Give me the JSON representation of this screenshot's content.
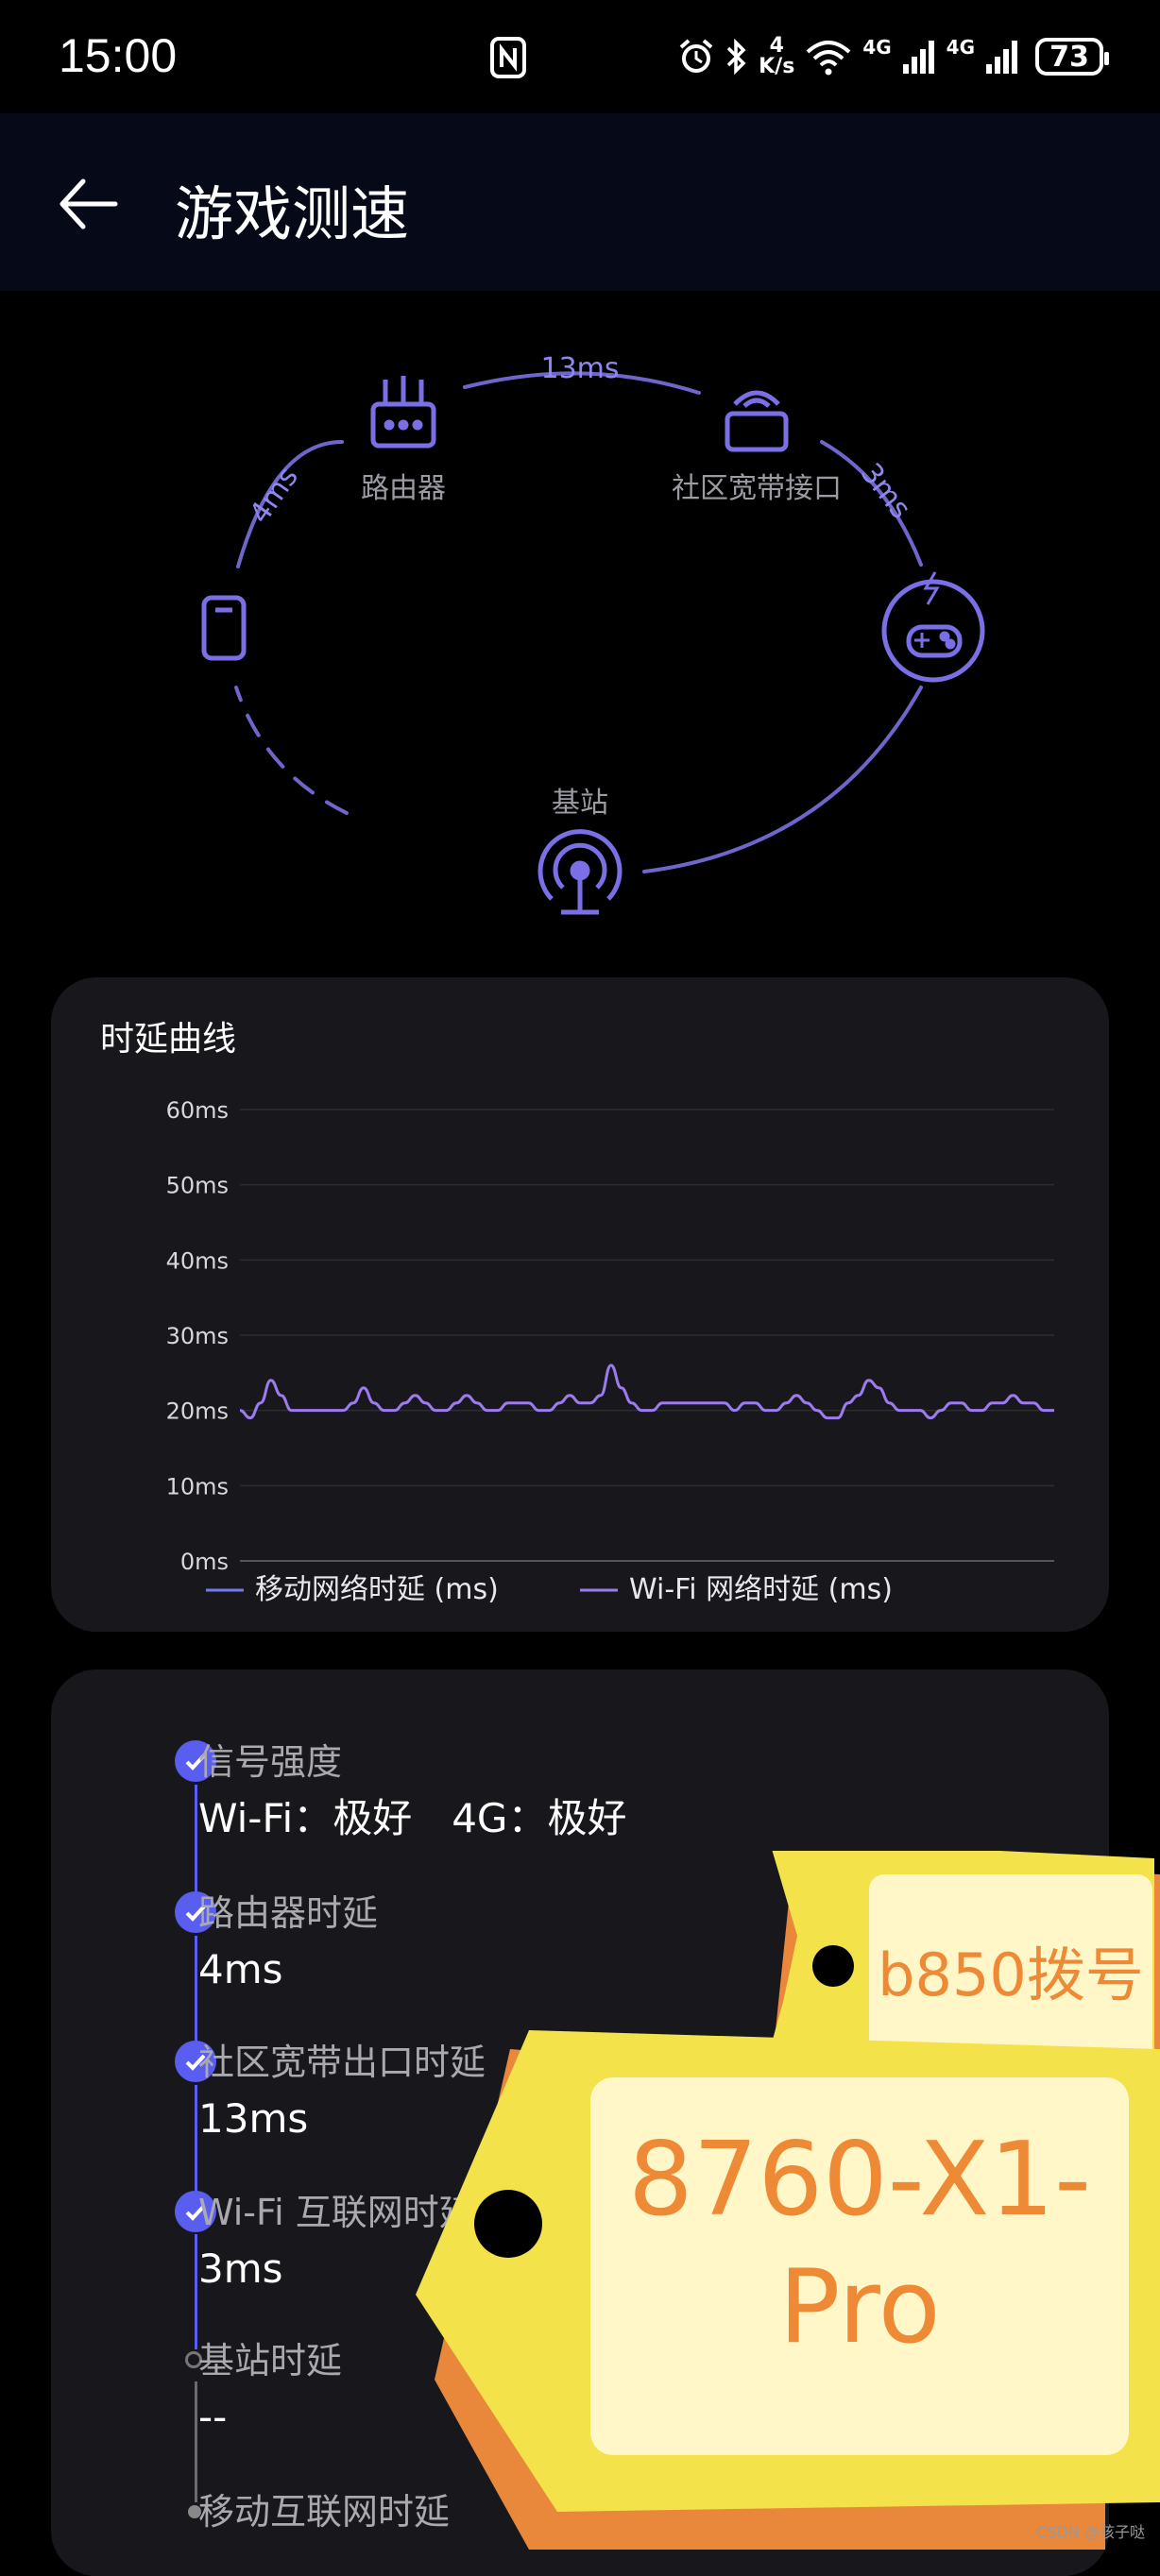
{
  "status_bar": {
    "time": "15:00",
    "net_speed_value": "4",
    "net_speed_unit": "K/s",
    "network_1": "4G",
    "network_2": "4G",
    "battery": "73"
  },
  "header": {
    "title": "游戏测速",
    "back_icon": "arrow-left-icon"
  },
  "topology": {
    "router_label": "路由器",
    "broadband_label": "社区宽带接口",
    "base_station_label": "基站",
    "phone_router_latency": "4ms",
    "router_broadband_latency": "13ms",
    "broadband_game_latency": "3ms",
    "accent_color": "#7b6fe6"
  },
  "chart": {
    "title": "时延曲线",
    "chart_data": {
      "type": "line",
      "title": "时延曲线",
      "ylim": [
        0,
        60
      ],
      "y_ticks": [
        "0ms",
        "10ms",
        "20ms",
        "30ms",
        "40ms",
        "50ms",
        "60ms"
      ],
      "grid": true,
      "legend_placement": "bottom",
      "series": [
        {
          "name": "移动网络时延 (ms)",
          "color": "#6f7cf0",
          "values": []
        },
        {
          "name": "Wi-Fi 网络时延 (ms)",
          "color": "#9b7bee",
          "values": [
            20,
            19,
            21,
            24,
            22,
            20,
            20,
            20,
            20,
            20,
            20,
            21,
            23,
            21,
            20,
            20,
            21,
            22,
            21,
            20,
            20,
            21,
            22,
            21,
            20,
            20,
            21,
            21,
            21,
            20,
            20,
            21,
            22,
            21,
            21,
            22,
            26,
            23,
            21,
            20,
            20,
            21,
            21,
            21,
            21,
            21,
            21,
            21,
            20,
            21,
            21,
            20,
            20,
            21,
            22,
            21,
            20,
            19,
            19,
            21,
            22,
            24,
            23,
            21,
            20,
            20,
            20,
            19,
            20,
            21,
            21,
            20,
            20,
            21,
            21,
            22,
            21,
            21,
            20,
            20
          ]
        }
      ]
    }
  },
  "checklist": {
    "items": [
      {
        "label": "信号强度",
        "value": "Wi-Fi：极好　4G：极好",
        "status": "done"
      },
      {
        "label": "路由器时延",
        "value": "4ms",
        "status": "done"
      },
      {
        "label": "社区宽带出口时延",
        "value": "13ms",
        "status": "done"
      },
      {
        "label": "Wi-Fi 互联网时延",
        "value": "3ms",
        "status": "done"
      },
      {
        "label": "基站时延",
        "value": "--",
        "status": "pending"
      },
      {
        "label": "移动互联网时延",
        "value": "",
        "status": "waiting"
      }
    ]
  },
  "overlay_tags": {
    "small_tag": "b850拨号",
    "large_tag_line1": "8760-X1-",
    "large_tag_line2": "Pro"
  },
  "watermark": "CSDN @孩子哒"
}
